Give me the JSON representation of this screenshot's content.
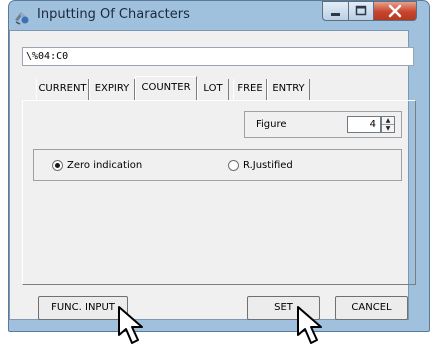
{
  "window": {
    "title": "Inputting Of Characters"
  },
  "input": {
    "value": "\\%04:C0"
  },
  "tabs": [
    {
      "label": "CURRENT"
    },
    {
      "label": "EXPIRY"
    },
    {
      "label": "COUNTER",
      "active": true
    },
    {
      "label": "LOT"
    },
    {
      "label": "FREE"
    },
    {
      "label": "ENTRY"
    }
  ],
  "figure": {
    "label": "Figure",
    "value": "4"
  },
  "radios": [
    {
      "label": "Zero indication",
      "checked": true
    },
    {
      "label": "R.Justified",
      "checked": false
    }
  ],
  "buttons": {
    "func_input": "FUNC. INPUT",
    "set": "SET",
    "cancel": "CANCEL"
  },
  "colors": {
    "window_frame": "#9fc1de",
    "client_bg": "#f0f0f0",
    "close_button": "#c8442b"
  }
}
